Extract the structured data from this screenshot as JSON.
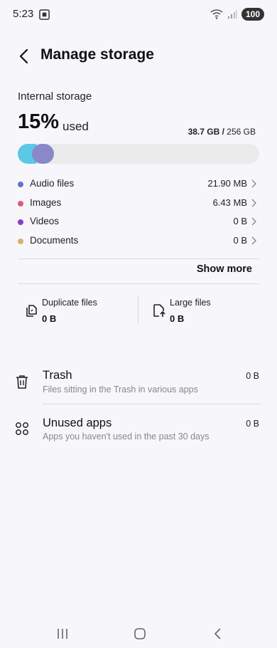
{
  "status": {
    "time": "5:23",
    "battery": "100"
  },
  "header": {
    "title": "Manage storage"
  },
  "storage": {
    "section_label": "Internal storage",
    "percent": "15%",
    "used_label": "used",
    "used_amount": "38.7 GB",
    "separator": " / ",
    "total": "256 GB",
    "bar_fill_fraction": 0.15,
    "colors": {
      "cyan": "#5ac8e6",
      "lavender": "#8a88c8",
      "track": "#ebebeb"
    }
  },
  "categories": [
    {
      "label": "Audio files",
      "value": "21.90 MB",
      "color": "#6b6fd0"
    },
    {
      "label": "Images",
      "value": "6.43 MB",
      "color": "#e05a78"
    },
    {
      "label": "Videos",
      "value": "0 B",
      "color": "#8a3fc8"
    },
    {
      "label": "Documents",
      "value": "0 B",
      "color": "#d9b070"
    }
  ],
  "show_more": "Show more",
  "tiles": [
    {
      "label": "Duplicate files",
      "value": "0 B",
      "icon": "duplicate-files-icon"
    },
    {
      "label": "Large files",
      "value": "0 B",
      "icon": "large-files-icon"
    }
  ],
  "list": [
    {
      "title": "Trash",
      "subtitle": "Files sitting in the Trash in various apps",
      "value": "0 B",
      "icon": "trash-icon"
    },
    {
      "title": "Unused apps",
      "subtitle": "Apps you haven't used in the past 30 days",
      "value": "0 B",
      "icon": "apps-icon"
    }
  ]
}
